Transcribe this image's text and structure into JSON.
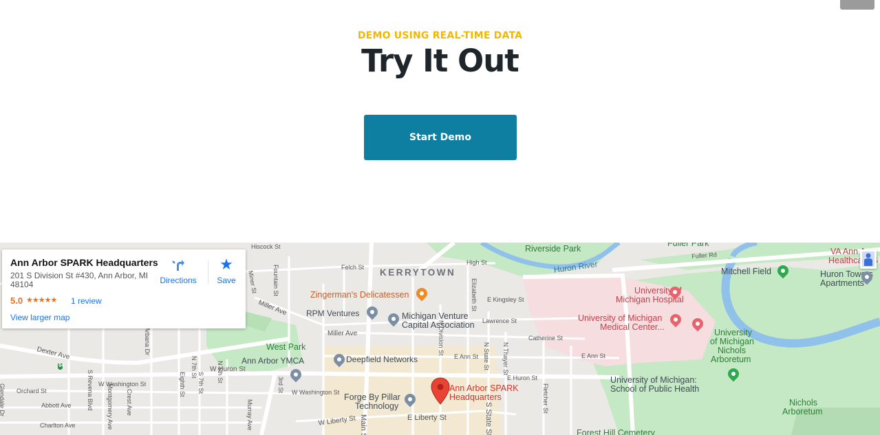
{
  "hero": {
    "eyebrow": "DEMO USING REAL-TIME DATA",
    "title": "Try It Out",
    "start_button": "Start Demo"
  },
  "colors": {
    "accent_yellow": "#f2b705",
    "button_blue": "#0e7fa1",
    "title_dark": "#1f262b",
    "map_link_blue": "#1a73e8",
    "rating_orange": "#e7711b",
    "marker_red": "#ea4335"
  },
  "infocard": {
    "name": "Ann Arbor SPARK Headquarters",
    "address": "201 S Division St #430, Ann Arbor, MI 48104",
    "rating": "5.0",
    "stars": "★★★★★",
    "reviews": "1 review",
    "directions": "Directions",
    "save": "Save",
    "larger_map": "View larger map",
    "directions_icon": "directions-arrow-icon",
    "save_icon": "star-icon"
  },
  "map": {
    "marker_label": "Ann Arbor SPARK\nHeadquarters",
    "neighborhood": "KERRYTOWN",
    "places": {
      "riverside_park": "Riverside Park",
      "fuller_park": "Fuller Park",
      "huron_river": "Huron River",
      "mitchell_field": "Mitchell Field",
      "va": "VA Ann A",
      "va2": "Healthcare S",
      "huron_towers": "Huron Towers",
      "huron_towers2": "Apartments",
      "um_hospital": "University of",
      "um_hospital2": "Michigan Hospital",
      "um_medical": "University of Michigan",
      "um_medical2": "Medical Center...",
      "um_arb1": "University",
      "um_arb2": "of Michigan",
      "um_arb3": "Nichols",
      "um_arb4": "Arboretum",
      "zingermans": "Zingerman's Delicatessen",
      "rpm": "RPM Ventures",
      "mvca1": "Michigan Venture",
      "mvca2": "Capital Association",
      "west_park": "West Park",
      "ymca": "Ann Arbor YMCA",
      "deepfield": "Deepfield Networks",
      "forge1": "Forge By Pillar",
      "forge2": "Technology",
      "sph1": "University of Michigan:",
      "sph2": "School of Public Health",
      "nichols1": "Nichols",
      "nichols2": "Arboretum",
      "forest_hill": "Forest Hill Cemetery"
    },
    "streets": {
      "hiscock": "Hiscock St",
      "felch": "Felch St",
      "high": "High St",
      "fuller_rd": "Fuller Rd",
      "miller_ave": "Miller Ave",
      "miller_ave2": "Miller Ave",
      "kingsley": "E Kingsley St",
      "lawrence": "Lawrence St",
      "catherine": "Catherine St",
      "ann": "E Ann St",
      "ann2": "E Ann St",
      "huron_e": "E Huron St",
      "huron_w": "W Huron St",
      "huron_e2": "E Huron St",
      "dexter": "Dexter Ave",
      "washington_w": "W Washington St",
      "washington_w2": "W Washington St",
      "orchard": "Orchard St",
      "abbott": "Abbott Ave",
      "charlton": "Charlton Ave",
      "liberty_w": "W Liberty St",
      "liberty_e": "E Liberty St",
      "n7th": "N 7th St",
      "n5th": "N 5th St",
      "s7th": "S 7th St",
      "eighth": "Eighth St",
      "3rd": "3rd St",
      "arbana": "Arbana Dr",
      "n_division": "N Division St",
      "n_state": "N State St",
      "s_state": "S State St",
      "n_thayer": "N Thayer St",
      "fletcher": "Fletcher St",
      "elizabeth": "Elizabeth St",
      "fountain": "Fountain St",
      "miner": "Miner St",
      "main": "Main St",
      "murray": "Murray Ave",
      "crest": "Crest Ave",
      "montgomery": "Montgomery Ave",
      "s_revena": "S Revena Blvd",
      "glendale": "Glendale Dr",
      "route": "94"
    }
  }
}
